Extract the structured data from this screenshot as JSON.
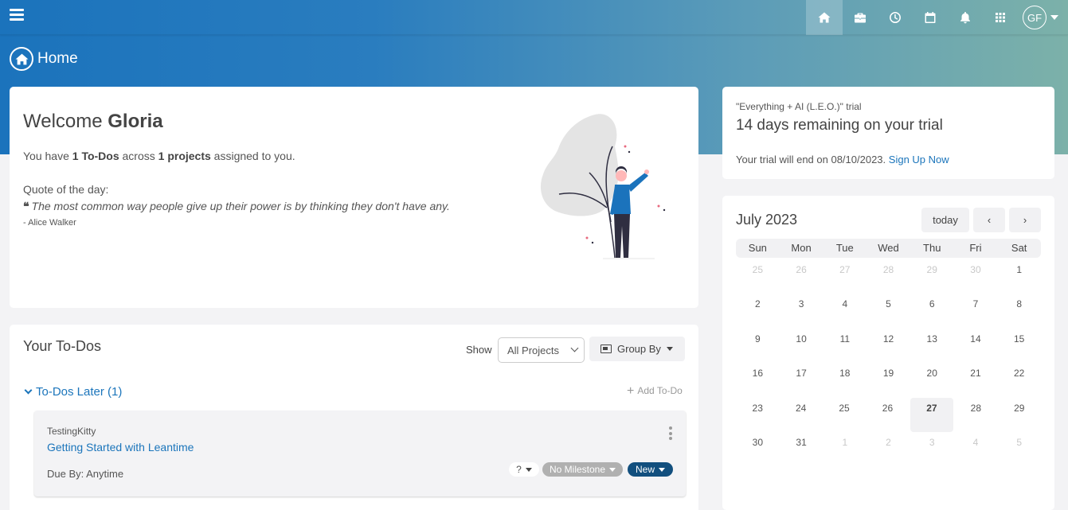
{
  "header": {
    "menu_icon": "hamburger-icon",
    "nav_icons": [
      {
        "name": "home-icon",
        "active": true
      },
      {
        "name": "briefcase-icon",
        "active": false
      },
      {
        "name": "clock-icon",
        "active": false
      },
      {
        "name": "calendar-icon",
        "active": false
      },
      {
        "name": "bell-icon",
        "active": false
      },
      {
        "name": "apps-grid-icon",
        "active": false
      }
    ],
    "user_initials": "GF",
    "brand_color": "#1b73bc"
  },
  "page": {
    "title": "Home"
  },
  "welcome": {
    "greeting": "Welcome",
    "name": "Gloria",
    "summary_prefix": "You have",
    "todo_count": "1 To-Dos",
    "summary_mid": "across",
    "project_count": "1 projects",
    "summary_suffix": "assigned to you.",
    "quote_label": "Quote of the day:",
    "quote_mark": "❝",
    "quote": "The most common way people give up their power is by thinking they don't have any.",
    "author": "- Alice Walker"
  },
  "trial": {
    "plan": "\"Everything + AI (L.E.O.)\" trial",
    "remaining": "14 days remaining on your trial",
    "ends_text": "Your trial will end on 08/10/2023.",
    "signup_link": "Sign Up Now"
  },
  "calendar": {
    "title": "July 2023",
    "today_label": "today",
    "prev_label": "‹",
    "next_label": "›",
    "weekdays": [
      "Sun",
      "Mon",
      "Tue",
      "Wed",
      "Thu",
      "Fri",
      "Sat"
    ],
    "weeks": [
      [
        {
          "d": "25",
          "o": true
        },
        {
          "d": "26",
          "o": true
        },
        {
          "d": "27",
          "o": true
        },
        {
          "d": "28",
          "o": true
        },
        {
          "d": "29",
          "o": true
        },
        {
          "d": "30",
          "o": true
        },
        {
          "d": "1"
        }
      ],
      [
        {
          "d": "2"
        },
        {
          "d": "3"
        },
        {
          "d": "4"
        },
        {
          "d": "5"
        },
        {
          "d": "6"
        },
        {
          "d": "7"
        },
        {
          "d": "8"
        }
      ],
      [
        {
          "d": "9"
        },
        {
          "d": "10"
        },
        {
          "d": "11"
        },
        {
          "d": "12"
        },
        {
          "d": "13"
        },
        {
          "d": "14"
        },
        {
          "d": "15"
        }
      ],
      [
        {
          "d": "16"
        },
        {
          "d": "17"
        },
        {
          "d": "18"
        },
        {
          "d": "19"
        },
        {
          "d": "20"
        },
        {
          "d": "21"
        },
        {
          "d": "22"
        }
      ],
      [
        {
          "d": "23"
        },
        {
          "d": "24"
        },
        {
          "d": "25"
        },
        {
          "d": "26"
        },
        {
          "d": "27",
          "t": true
        },
        {
          "d": "28"
        },
        {
          "d": "29"
        }
      ],
      [
        {
          "d": "30"
        },
        {
          "d": "31"
        },
        {
          "d": "1",
          "o": true
        },
        {
          "d": "2",
          "o": true
        },
        {
          "d": "3",
          "o": true
        },
        {
          "d": "4",
          "o": true
        },
        {
          "d": "5",
          "o": true
        }
      ]
    ],
    "today": "27"
  },
  "todos": {
    "title": "Your To-Dos",
    "show_label": "Show",
    "project_filter": "All Projects",
    "group_by_label": "Group By",
    "group_title": "To-Dos Later (1)",
    "add_label": "Add To-Do",
    "items": [
      {
        "project": "TestingKitty",
        "title": "Getting Started with Leantime",
        "due": "Due By:  Anytime",
        "effort": "?",
        "milestone": "No Milestone",
        "status": "New",
        "status_color": "#124f7e"
      }
    ]
  }
}
